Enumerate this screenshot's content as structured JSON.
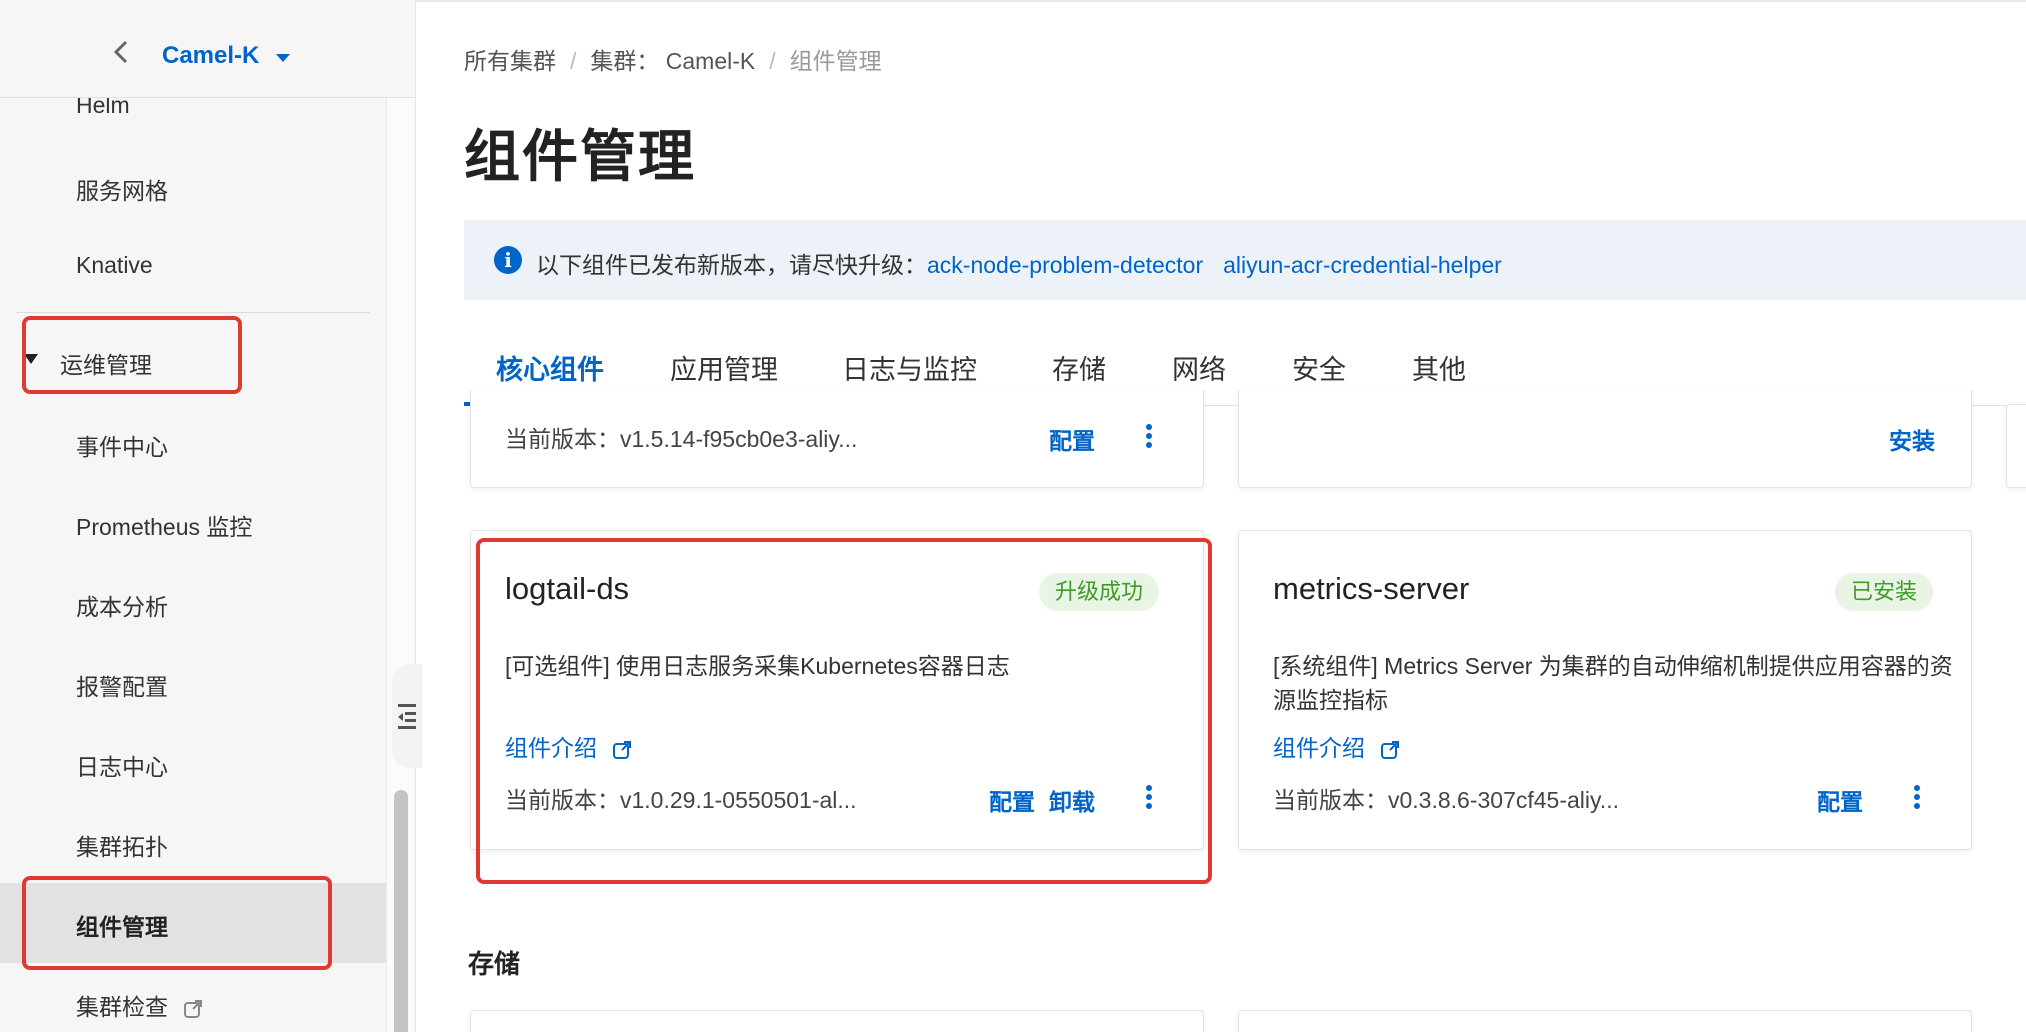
{
  "sidebar": {
    "cluster_name": "Camel-K",
    "items": [
      {
        "label": "Helm"
      },
      {
        "label": "服务网格"
      },
      {
        "label": "Knative"
      }
    ],
    "group_label": "运维管理",
    "group_items": [
      {
        "label": "事件中心"
      },
      {
        "label": "Prometheus 监控"
      },
      {
        "label": "成本分析"
      },
      {
        "label": "报警配置"
      },
      {
        "label": "日志中心"
      },
      {
        "label": "集群拓扑"
      },
      {
        "label": "组件管理"
      },
      {
        "label": "集群检查"
      }
    ],
    "active_item": "组件管理"
  },
  "breadcrumb": {
    "root": "所有集群",
    "cluster": "集群： Camel-K",
    "current": "组件管理",
    "separator": "/"
  },
  "page": {
    "title": "组件管理"
  },
  "notice": {
    "text": "以下组件已发布新版本，请尽快升级：",
    "links": [
      "ack-node-problem-detector",
      "aliyun-acr-credential-helper"
    ]
  },
  "tabs": [
    "核心组件",
    "应用管理",
    "日志与监控",
    "存储",
    "网络",
    "安全",
    "其他"
  ],
  "active_tab": "核心组件",
  "cards": {
    "top_left": {
      "version": "当前版本：v1.5.14-f95cb0e3-aliy...",
      "action": "配置"
    },
    "top_right": {
      "action": "安装"
    },
    "logtail": {
      "name": "logtail-ds",
      "status": "升级成功",
      "description": "[可选组件] 使用日志服务采集Kubernetes容器日志",
      "intro_link": "组件介绍",
      "version": "当前版本：v1.0.29.1-0550501-al...",
      "action_config": "配置",
      "action_uninstall": "卸载"
    },
    "metrics": {
      "name": "metrics-server",
      "status": "已安装",
      "description": "[系统组件] Metrics Server 为集群的自动伸缩机制提供应用容器的资源监控指标",
      "intro_link": "组件介绍",
      "version": "当前版本：v0.3.8.6-307cf45-aliy...",
      "action_config": "配置"
    }
  },
  "section": {
    "storage_title": "存储"
  },
  "colors": {
    "link": "#0064c8",
    "success_bg": "#e9f5e4",
    "success_text": "#3f9a27",
    "annotation": "#e03a30",
    "accent": "#ff6a00"
  }
}
